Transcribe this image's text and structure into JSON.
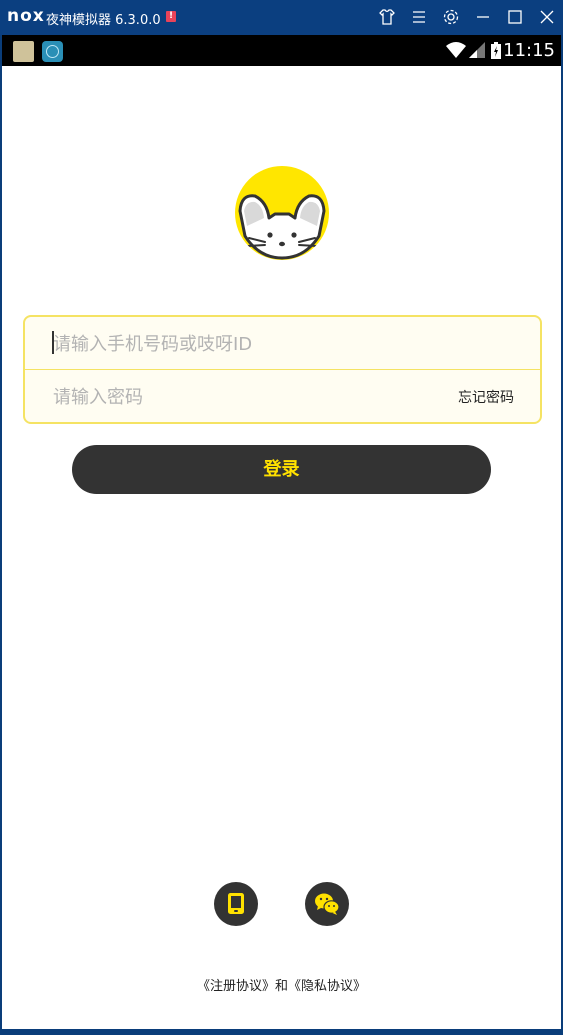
{
  "window": {
    "logo": "nox",
    "title": "夜神模拟器 6.3.0.0",
    "alert_badge": "!"
  },
  "statusbar": {
    "time": "11:15"
  },
  "login": {
    "account_placeholder": "请输入手机号码或吱呀ID",
    "password_placeholder": "请输入密码",
    "forgot_label": "忘记密码",
    "submit_label": "登录"
  },
  "agreement": {
    "register_label": "《注册协议》",
    "joiner": "和",
    "privacy_label": "《隐私协议》"
  },
  "colors": {
    "accent": "#ffe100",
    "button_bg": "#333333",
    "field_border": "#f5e363",
    "field_bg": "#fffdf2",
    "titlebar_bg": "#0b3f80"
  },
  "icons": {
    "avatar": "mouse-avatar-icon",
    "phone_login": "tablet-icon",
    "wechat_login": "wechat-icon"
  }
}
